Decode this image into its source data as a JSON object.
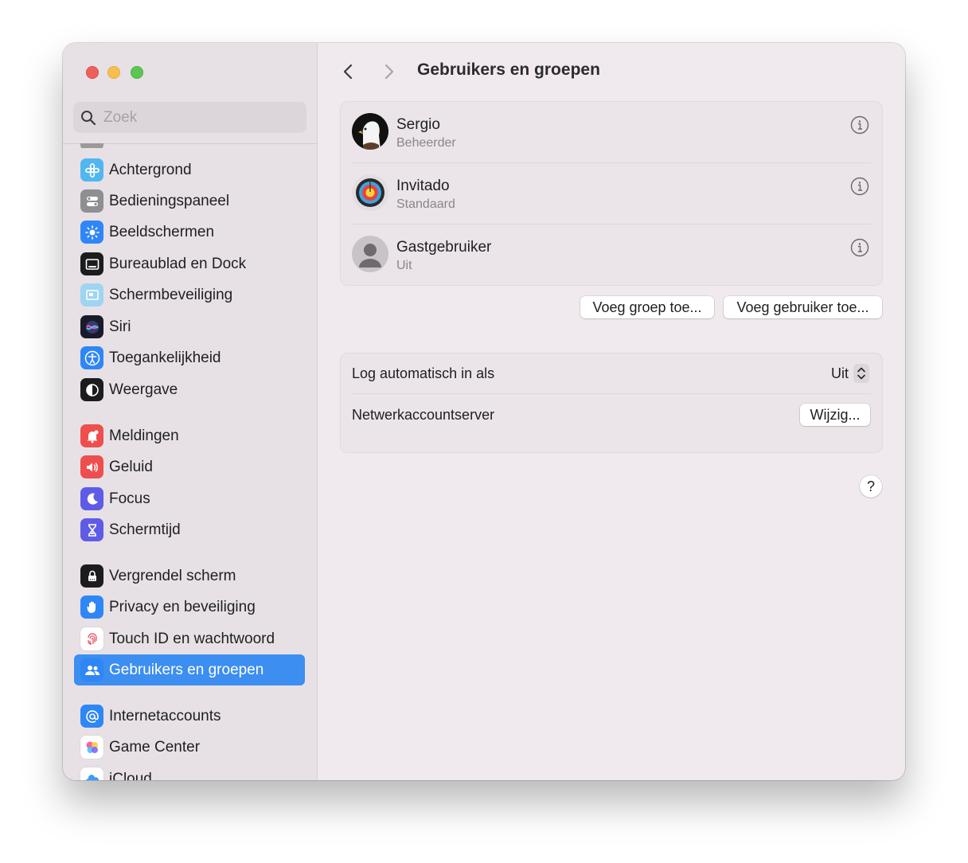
{
  "window": {
    "title": "Gebruikers en groepen"
  },
  "search": {
    "placeholder": "Zoek"
  },
  "sidebar": {
    "items": [
      {
        "label": "Achtergrond",
        "icon": "wallpaper-icon"
      },
      {
        "label": "Bedieningspaneel",
        "icon": "control-center-icon"
      },
      {
        "label": "Beeldschermen",
        "icon": "displays-icon"
      },
      {
        "label": "Bureaublad en Dock",
        "icon": "desktop-dock-icon"
      },
      {
        "label": "Schermbeveiliging",
        "icon": "screen-saver-icon"
      },
      {
        "label": "Siri",
        "icon": "siri-icon"
      },
      {
        "label": "Toegankelijkheid",
        "icon": "accessibility-icon"
      },
      {
        "label": "Weergave",
        "icon": "appearance-icon"
      },
      {
        "label": "Meldingen",
        "icon": "notifications-icon"
      },
      {
        "label": "Geluid",
        "icon": "sound-icon"
      },
      {
        "label": "Focus",
        "icon": "focus-moon-icon"
      },
      {
        "label": "Schermtijd",
        "icon": "hourglass-icon"
      },
      {
        "label": "Vergrendel scherm",
        "icon": "lock-screen-icon"
      },
      {
        "label": "Privacy en beveiliging",
        "icon": "privacy-hand-icon"
      },
      {
        "label": "Touch ID en wachtwoord",
        "icon": "fingerprint-icon"
      },
      {
        "label": "Gebruikers en groepen",
        "icon": "users-icon",
        "selected": true
      },
      {
        "label": "Internetaccounts",
        "icon": "at-sign-icon"
      },
      {
        "label": "Game Center",
        "icon": "game-center-icon"
      },
      {
        "label": "iCloud",
        "icon": "icloud-icon"
      }
    ]
  },
  "users": [
    {
      "name": "Sergio",
      "role": "Beheerder",
      "avatar": "eagle-avatar"
    },
    {
      "name": "Invitado",
      "role": "Standaard",
      "avatar": "target-avatar"
    },
    {
      "name": "Gastgebruiker",
      "role": "Uit",
      "avatar": "person-silhouette-avatar"
    }
  ],
  "buttons": {
    "add_group": "Voeg groep toe...",
    "add_user": "Voeg gebruiker toe..."
  },
  "settings": {
    "auto_login_label": "Log automatisch in als",
    "auto_login_value": "Uit",
    "network_server_label": "Netwerkaccountserver",
    "network_server_button": "Wijzig..."
  },
  "help_label": "?",
  "colors": {
    "accent": "#3c8ef0",
    "window_bg": "#f0eaef",
    "sidebar_bg": "#e7e1e6"
  }
}
